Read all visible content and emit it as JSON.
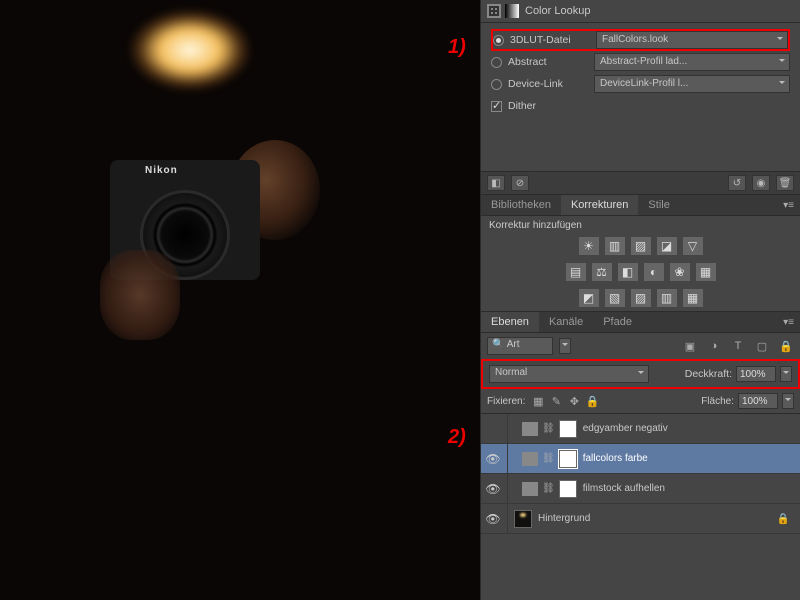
{
  "annotations": {
    "a1": "1)",
    "a2": "2)"
  },
  "canvas": {
    "camera_brand": "Nikon"
  },
  "color_lookup": {
    "title": "Color Lookup",
    "lut_label": "3DLUT-Datei",
    "lut_value": "FallColors.look",
    "abstract_label": "Abstract",
    "abstract_value": "Abstract-Profil lad...",
    "devicelink_label": "Device-Link",
    "devicelink_value": "DeviceLink-Profil l...",
    "dither_label": "Dither"
  },
  "panels": {
    "tabs_a": [
      "Bibliotheken",
      "Korrekturen",
      "Stile"
    ],
    "adjustments_hint": "Korrektur hinzufügen",
    "tabs_b": [
      "Ebenen",
      "Kanäle",
      "Pfade"
    ],
    "search_placeholder": "Art"
  },
  "layer_panel": {
    "blend_mode": "Normal",
    "opacity_label": "Deckkraft:",
    "opacity_value": "100%",
    "lock_label": "Fixieren:",
    "fill_label": "Fläche:",
    "fill_value": "100%"
  },
  "layers": [
    {
      "name": "edgyamber negativ",
      "visible": false,
      "adjustment": true,
      "selected": false
    },
    {
      "name": "fallcolors farbe",
      "visible": true,
      "adjustment": true,
      "selected": true
    },
    {
      "name": "filmstock aufhellen",
      "visible": true,
      "adjustment": true,
      "selected": false
    },
    {
      "name": "Hintergrund",
      "visible": true,
      "adjustment": false,
      "selected": false
    }
  ],
  "icons": {
    "adj_row1": [
      "☀",
      "▥",
      "▨",
      "◪",
      "▽"
    ],
    "adj_row2": [
      "▤",
      "⚖",
      "◧",
      "◐",
      "❀",
      "▦"
    ],
    "adj_row3": [
      "◩",
      "▧",
      "▨",
      "▥",
      "▦"
    ],
    "btn_bar": [
      "◧",
      "⊘",
      "◉",
      "↺",
      "◉",
      "🗑"
    ],
    "layer_ctrl": [
      "▣",
      "◑",
      "T",
      "▢",
      "🔒"
    ],
    "lock": [
      "▦",
      "✎",
      "✥",
      "🔒"
    ]
  }
}
